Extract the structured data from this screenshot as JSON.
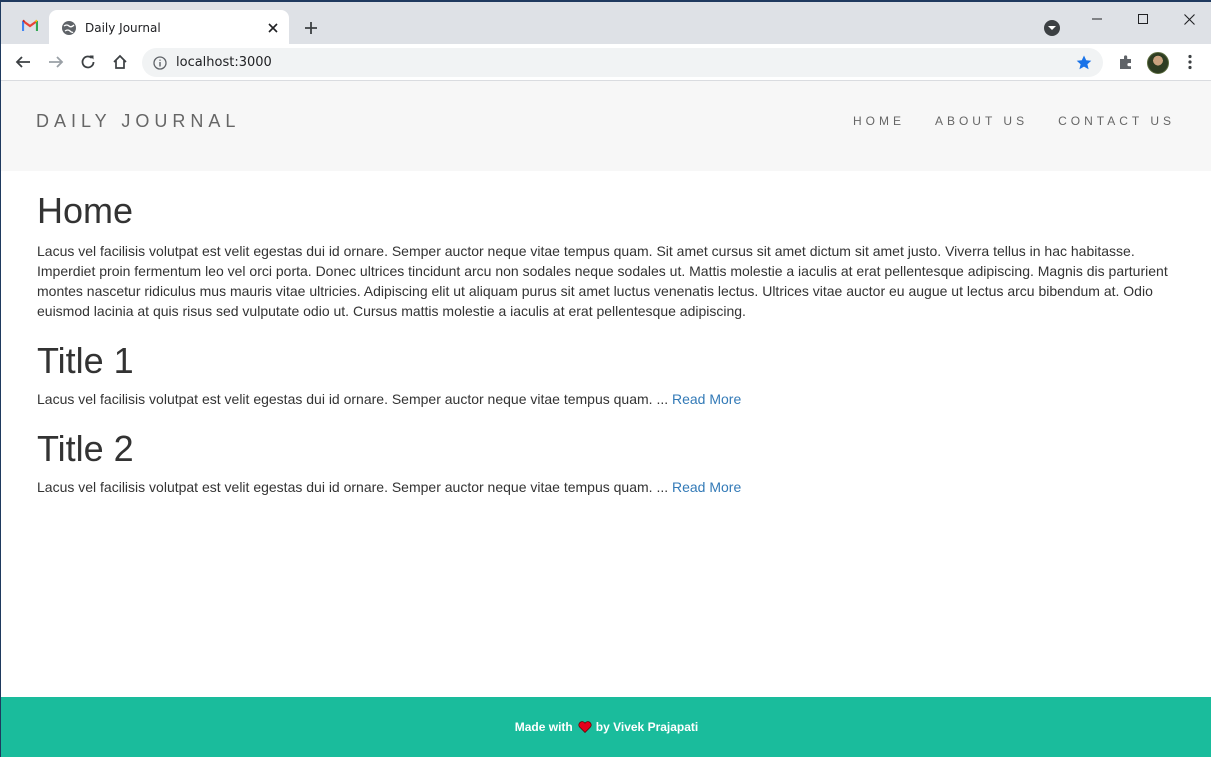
{
  "browser": {
    "tab_title": "Daily Journal",
    "url": "localhost:3000",
    "icons": {
      "gmail_tab": "gmail-icon",
      "tab_favicon": "globe-icon",
      "tab_close": "close-icon",
      "new_tab": "plus-icon",
      "tab_search": "chevron-down-icon",
      "back": "arrow-left-icon",
      "forward": "arrow-right-icon",
      "reload": "reload-icon",
      "home": "home-icon",
      "site_info": "info-icon",
      "bookmark": "star-icon",
      "extensions": "puzzle-icon",
      "menu": "kebab-menu-icon"
    }
  },
  "site": {
    "brand": "DAILY JOURNAL",
    "nav": [
      {
        "label": "HOME"
      },
      {
        "label": "ABOUT US"
      },
      {
        "label": "CONTACT US"
      }
    ]
  },
  "home": {
    "heading": "Home",
    "text": "Lacus vel facilisis volutpat est velit egestas dui id ornare. Semper auctor neque vitae tempus quam. Sit amet cursus sit amet dictum sit amet justo. Viverra tellus in hac habitasse. Imperdiet proin fermentum leo vel orci porta. Donec ultrices tincidunt arcu non sodales neque sodales ut. Mattis molestie a iaculis at erat pellentesque adipiscing. Magnis dis parturient montes nascetur ridiculus mus mauris vitae ultricies. Adipiscing elit ut aliquam purus sit amet luctus venenatis lectus. Ultrices vitae auctor eu augue ut lectus arcu bibendum at. Odio euismod lacinia at quis risus sed vulputate odio ut. Cursus mattis molestie a iaculis at erat pellentesque adipiscing."
  },
  "posts": [
    {
      "title": "Title 1",
      "excerpt": "Lacus vel facilisis volutpat est velit egestas dui id ornare. Semper auctor neque vitae tempus quam. ... ",
      "link": "Read More"
    },
    {
      "title": "Title 2",
      "excerpt": "Lacus vel facilisis volutpat est velit egestas dui id ornare. Semper auctor neque vitae tempus quam. ... ",
      "link": "Read More"
    }
  ],
  "footer": {
    "prefix": "Made with",
    "suffix": "by Vivek Prajapati",
    "icon": "heart-icon"
  },
  "colors": {
    "footer_bg": "#1abc9c",
    "nav_bg": "#f7f7f7",
    "link": "#337ab7",
    "heart": "#e3001b"
  }
}
